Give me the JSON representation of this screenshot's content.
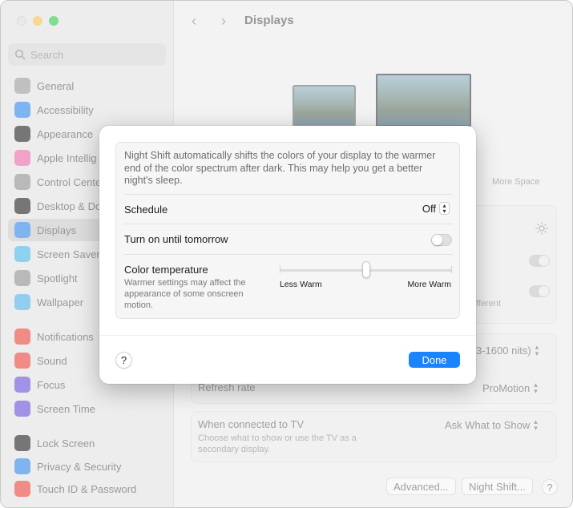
{
  "window": {
    "title": "Displays",
    "nav_back": "‹",
    "nav_forward": "›"
  },
  "sidebar": {
    "search_placeholder": "Search",
    "items": [
      {
        "label": "General",
        "color": "#9a9a9a"
      },
      {
        "label": "Accessibility",
        "color": "#2f86e6"
      },
      {
        "label": "Appearance",
        "color": "#222222"
      },
      {
        "label": "Apple Intellig",
        "color": "#e86aa8"
      },
      {
        "label": "Control Cente",
        "color": "#8f8f8f"
      },
      {
        "label": "Desktop & Do",
        "color": "#222222"
      },
      {
        "label": "Displays",
        "color": "#2f86e6"
      },
      {
        "label": "Screen Saver",
        "color": "#48b6e6"
      },
      {
        "label": "Spotlight",
        "color": "#8f8f8f"
      },
      {
        "label": "Wallpaper",
        "color": "#4fb0e6"
      },
      {
        "label": "Notifications",
        "color": "#e8453c"
      },
      {
        "label": "Sound",
        "color": "#e8453c"
      },
      {
        "label": "Focus",
        "color": "#6a4fd6"
      },
      {
        "label": "Screen Time",
        "color": "#6a4fd6"
      },
      {
        "label": "Lock Screen",
        "color": "#222222"
      },
      {
        "label": "Privacy & Security",
        "color": "#2f86e6"
      },
      {
        "label": "Touch ID & Password",
        "color": "#e8453c"
      }
    ]
  },
  "main": {
    "more_space": "More Space",
    "brightness_range_fragment": "3-1600 nits)",
    "different_fragment": "fferent",
    "refresh_rate_label": "Refresh rate",
    "refresh_rate_value": "ProMotion",
    "tv_label": "When connected to TV",
    "tv_sub": "Choose what to show or use the TV as a secondary display.",
    "tv_value": "Ask What to Show",
    "advanced_button": "Advanced...",
    "night_shift_button": "Night Shift...",
    "help": "?"
  },
  "sheet": {
    "description": "Night Shift automatically shifts the colors of your display to the warmer end of the color spectrum after dark. This may help you get a better night's sleep.",
    "schedule_label": "Schedule",
    "schedule_value": "Off",
    "turn_on_label": "Turn on until tomorrow",
    "turn_on_state": false,
    "color_temp_label": "Color temperature",
    "color_temp_sub": "Warmer settings may affect the appearance of some onscreen motion.",
    "slider_min_label": "Less Warm",
    "slider_max_label": "More Warm",
    "slider_value": 0.5,
    "help": "?",
    "done_label": "Done",
    "accent_color": "#1a84ff"
  }
}
